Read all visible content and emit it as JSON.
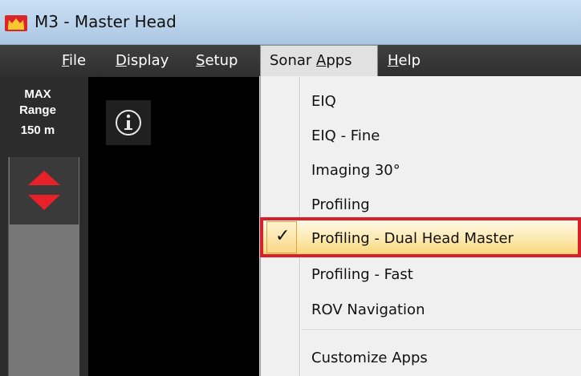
{
  "window": {
    "title": "M3 - Master Head",
    "icon": "master-head-app-icon"
  },
  "menubar": {
    "items": [
      {
        "label": "File",
        "underline": "F",
        "rest": "ile"
      },
      {
        "label": "Display",
        "underline": "D",
        "rest": "isplay"
      },
      {
        "label": "Setup",
        "underline": "S",
        "rest": "etup"
      },
      {
        "label": "Sonar Apps",
        "prefix": "Sonar ",
        "underline": "A",
        "rest": "pps",
        "active": true
      },
      {
        "label": "Help",
        "underline": "H",
        "rest": "elp"
      }
    ]
  },
  "range": {
    "line1": "MAX",
    "line2": "Range",
    "value": "150 m"
  },
  "sonar_apps_menu": {
    "items": [
      {
        "label": "EIQ"
      },
      {
        "label": "EIQ - Fine"
      },
      {
        "label": "Imaging 30°"
      },
      {
        "label": "Profiling"
      },
      {
        "label": "Profiling - Dual Head Master",
        "checked": true,
        "check_glyph": "✓"
      },
      {
        "label": "Profiling - Fast"
      },
      {
        "label": "ROV Navigation"
      },
      {
        "label": "Customize Apps"
      }
    ]
  },
  "colors": {
    "highlight_border": "#d9202a",
    "range_arrows": "#e8202a",
    "menubar": "#333333",
    "titlebar": "#bcd4ec"
  }
}
